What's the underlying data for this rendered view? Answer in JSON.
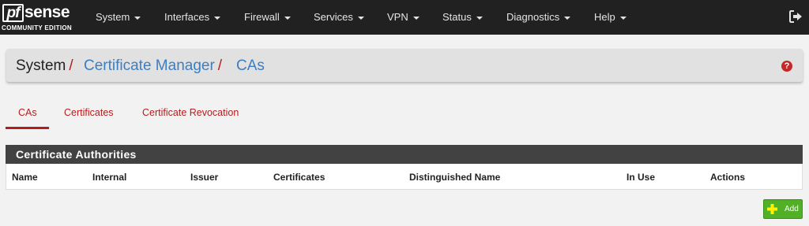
{
  "brand": {
    "logo_pf": "pf",
    "logo_sense": "sense",
    "edition": "COMMUNITY EDITION"
  },
  "nav": {
    "items": [
      {
        "label": "System"
      },
      {
        "label": "Interfaces"
      },
      {
        "label": "Firewall"
      },
      {
        "label": "Services"
      },
      {
        "label": "VPN"
      },
      {
        "label": "Status"
      },
      {
        "label": "Diagnostics"
      },
      {
        "label": "Help"
      }
    ]
  },
  "breadcrumb": {
    "root": "System",
    "separator": "/",
    "level2": "Certificate Manager",
    "level3": "CAs"
  },
  "help_label": "?",
  "tabs": [
    {
      "label": "CAs",
      "active": true
    },
    {
      "label": "Certificates",
      "active": false
    },
    {
      "label": "Certificate Revocation",
      "active": false
    }
  ],
  "panel": {
    "title": "Certificate Authorities",
    "columns": [
      "Name",
      "Internal",
      "Issuer",
      "Certificates",
      "Distinguished Name",
      "In Use",
      "Actions"
    ]
  },
  "add_button": {
    "label": "Add"
  },
  "colors": {
    "navbar": "#212121",
    "accent_red": "#b71c1c",
    "link_blue": "#3b7ec2",
    "panel_header": "#424242",
    "add_green": "#52b026"
  }
}
